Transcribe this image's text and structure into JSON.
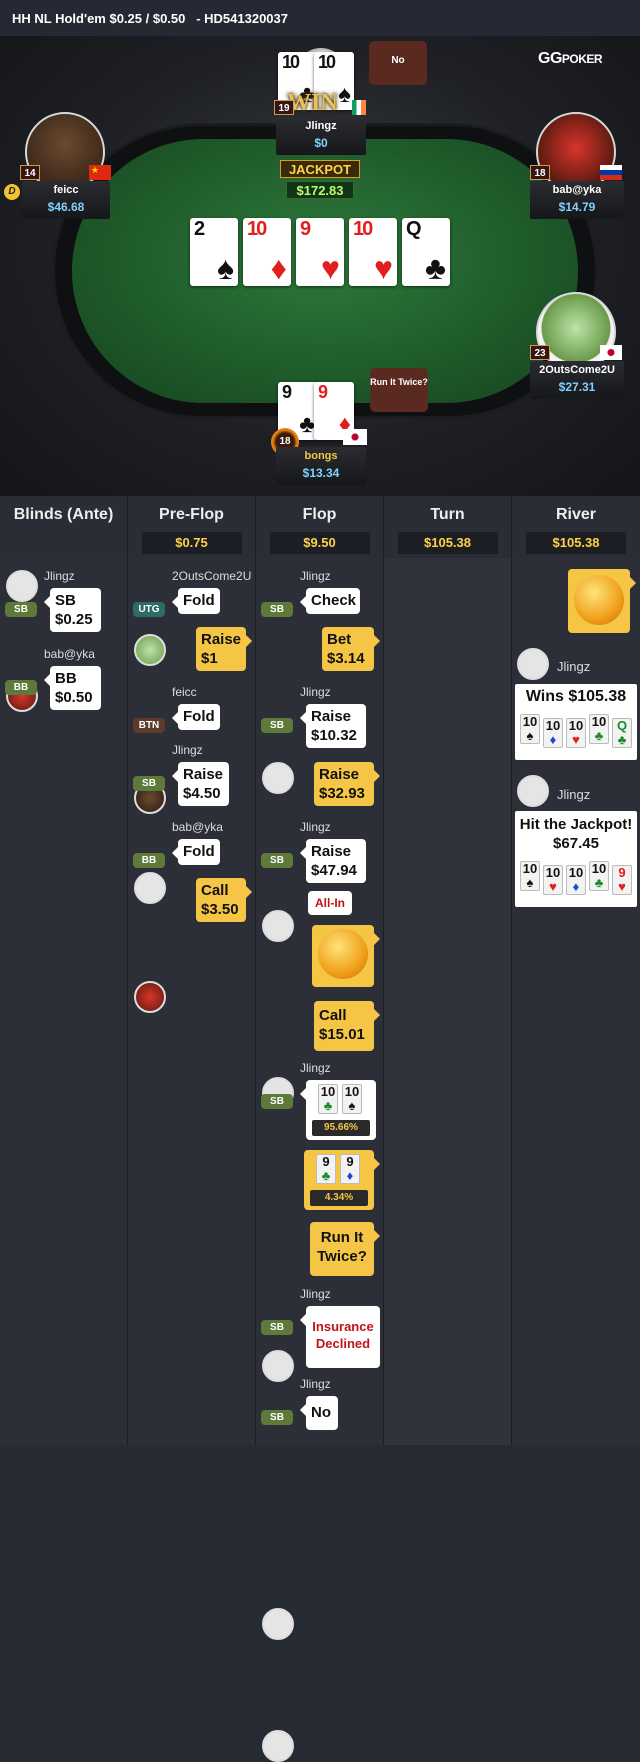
{
  "header": {
    "title": "HH NL Hold'em $0.25 / $0.50   - HD541320037"
  },
  "brand": {
    "logo": "GG",
    "logo_sub": "POKER"
  },
  "table": {
    "jackpot_label": "JACKPOT",
    "jackpot_amount": "$172.83",
    "board": [
      {
        "rank": "2",
        "suit": "♠",
        "color": "black"
      },
      {
        "rank": "10",
        "suit": "♦",
        "color": "red"
      },
      {
        "rank": "9",
        "suit": "♥",
        "color": "red"
      },
      {
        "rank": "10",
        "suit": "♥",
        "color": "red"
      },
      {
        "rank": "Q",
        "suit": "♣",
        "color": "black"
      }
    ],
    "players": {
      "top": {
        "name": "Jlingz",
        "stack": "$0",
        "level": "19",
        "cards": [
          {
            "rank": "10",
            "suit": "♣"
          },
          {
            "rank": "10",
            "suit": "♠"
          }
        ],
        "bubble": "No",
        "badge": "WIN"
      },
      "left": {
        "name": "feicc",
        "stack": "$46.68",
        "level": "14",
        "dealer": "D"
      },
      "right": {
        "name": "bab@yka",
        "stack": "$14.79",
        "level": "18"
      },
      "right_low": {
        "name": "2OutsCome2U",
        "stack": "$27.31",
        "level": "23"
      },
      "bottom": {
        "name": "bongs",
        "stack": "$13.34",
        "level": "18",
        "cards": [
          {
            "rank": "9",
            "suit": "♣"
          },
          {
            "rank": "9",
            "suit": "♦"
          }
        ],
        "bubble": "Run It Twice?"
      }
    }
  },
  "columns": [
    {
      "title": "Blinds (Ante)",
      "pot": ""
    },
    {
      "title": "Pre-Flop",
      "pot": "$0.75"
    },
    {
      "title": "Flop",
      "pot": "$9.50"
    },
    {
      "title": "Turn",
      "pot": "$105.38"
    },
    {
      "title": "River",
      "pot": "$105.38"
    }
  ],
  "blinds": [
    {
      "name": "Jlingz",
      "pos": "SB",
      "action": "SB",
      "amount": "$0.25"
    },
    {
      "name": "bab@yka",
      "pos": "BB",
      "action": "BB",
      "amount": "$0.50"
    }
  ],
  "preflop": {
    "a1": {
      "name": "2OutsCome2U",
      "pos": "UTG",
      "action": "Fold"
    },
    "h1": {
      "action": "Raise",
      "amount": "$1"
    },
    "a2": {
      "name": "feicc",
      "pos": "BTN",
      "action": "Fold"
    },
    "a3": {
      "name": "Jlingz",
      "pos": "SB",
      "action": "Raise",
      "amount": "$4.50"
    },
    "a4": {
      "name": "bab@yka",
      "pos": "BB",
      "action": "Fold"
    },
    "h2": {
      "action": "Call",
      "amount": "$3.50"
    }
  },
  "flop": {
    "a1": {
      "name": "Jlingz",
      "pos": "SB",
      "action": "Check"
    },
    "h1": {
      "action": "Bet",
      "amount": "$3.14"
    },
    "a2": {
      "name": "Jlingz",
      "pos": "SB",
      "action": "Raise",
      "amount": "$10.32"
    },
    "h2": {
      "action": "Raise",
      "amount": "$32.93"
    },
    "a3": {
      "name": "Jlingz",
      "pos": "SB",
      "action": "Raise",
      "amount": "$47.94",
      "tag": "All-In"
    },
    "h3": {
      "action": "Call",
      "amount": "$15.01"
    },
    "a4": {
      "name": "Jlingz",
      "pos": "SB",
      "equity": "95.66%",
      "cards": [
        {
          "rank": "10",
          "suit": "♣"
        },
        {
          "rank": "10",
          "suit": "♠"
        }
      ]
    },
    "h4": {
      "equity": "4.34%",
      "cards": [
        {
          "rank": "9",
          "suit": "♣"
        },
        {
          "rank": "9",
          "suit": "♦"
        }
      ]
    },
    "h5": {
      "line1": "Run It",
      "line2": "Twice?"
    },
    "a5": {
      "name": "Jlingz",
      "pos": "SB",
      "line1": "Insurance",
      "line2": "Declined"
    },
    "a6": {
      "name": "Jlingz",
      "pos": "SB",
      "action": "No"
    }
  },
  "river": {
    "r1": {
      "name": "Jlingz",
      "text": "Wins $105.38",
      "cards": [
        {
          "rank": "10",
          "suit": "♠"
        },
        {
          "rank": "10",
          "suit": "♦"
        },
        {
          "rank": "10",
          "suit": "♥"
        },
        {
          "rank": "10",
          "suit": "♣"
        },
        {
          "rank": "Q",
          "suit": "♣"
        }
      ]
    },
    "r2": {
      "name": "Jlingz",
      "text1": "Hit the Jackpot!",
      "text2": "$67.45",
      "cards": [
        {
          "rank": "10",
          "suit": "♠"
        },
        {
          "rank": "10",
          "suit": "♥"
        },
        {
          "rank": "10",
          "suit": "♦"
        },
        {
          "rank": "10",
          "suit": "♣"
        },
        {
          "rank": "9",
          "suit": "♥"
        }
      ]
    }
  },
  "colors": {
    "accent_gold": "#f5c545",
    "stack_blue": "#7fd0ff",
    "felt": "#1f5c2b",
    "allin_red": "#c0141a"
  }
}
